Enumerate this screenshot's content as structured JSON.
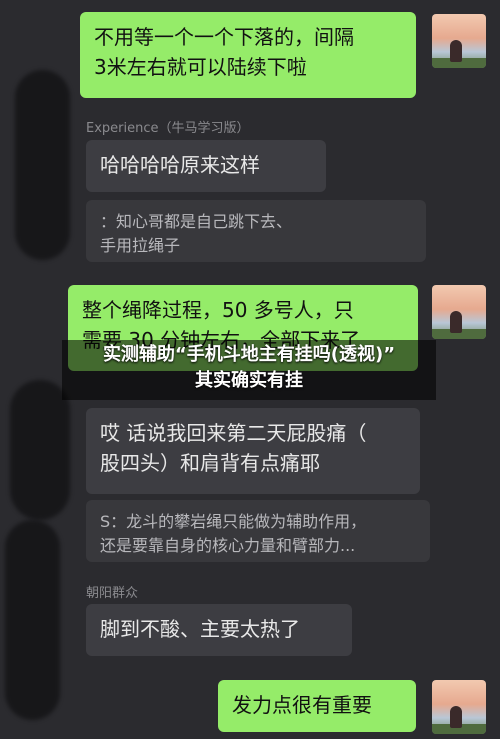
{
  "messages": [
    {
      "side": "right",
      "text": "不用等一个一个下落的，间隔\n3米左右就可以陆续下啦"
    },
    {
      "side": "left",
      "sender": "Experience（牛马学习版）",
      "text": "哈哈哈哈原来这样"
    },
    {
      "side": "left",
      "quote": "：知心哥都是自己跳下去、\n手用拉绳子"
    },
    {
      "side": "right",
      "text": "整个绳降过程，50 多号人，只\n需要 30 分钟左右，全部下来了"
    },
    {
      "side": "left",
      "text": "哎 话说我回来第二天屁股痛（\n股四头）和肩背有点痛耶"
    },
    {
      "side": "left",
      "quote": "S：龙斗的攀岩绳只能做为辅助作用，\n还是要靠自身的核心力量和臂部力..."
    },
    {
      "side": "left",
      "sender": "朝阳群众",
      "text": "脚到不酸、主要太热了"
    },
    {
      "side": "right",
      "text": "发力点很有重要"
    }
  ],
  "overlay": {
    "line1": "实测辅助“手机斗地主有挂吗(透视)”",
    "line2": "其实确实有挂"
  }
}
